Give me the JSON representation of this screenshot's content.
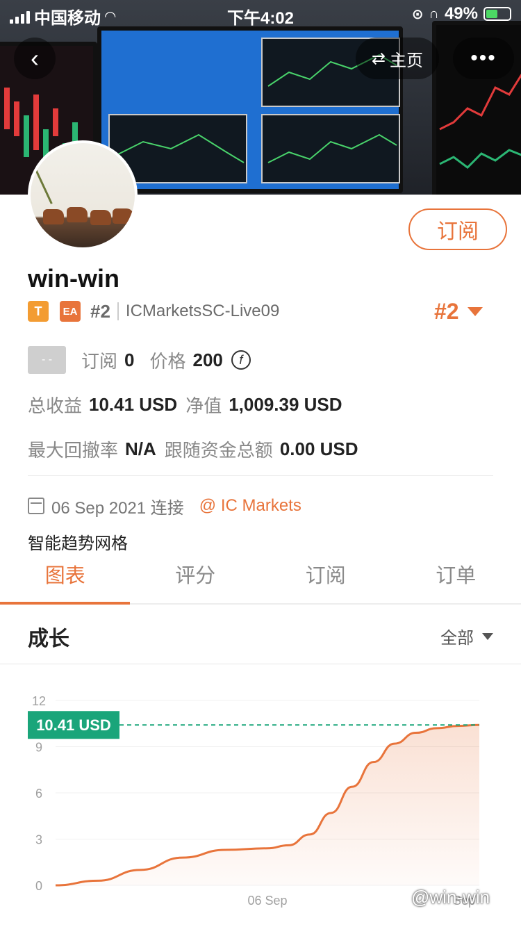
{
  "status_bar": {
    "carrier": "中国移动",
    "time": "下午4:02",
    "battery": "49%"
  },
  "nav": {
    "back_icon": "chevron-left-icon",
    "home_label": "主页",
    "home_icon": "swap-arrows-icon",
    "more_icon": "more-dots-icon"
  },
  "profile": {
    "username": "win-win",
    "subscribe_label": "订阅",
    "tag_t": "T",
    "tag_ea": "EA",
    "rank": "#2",
    "server": "ICMarketsSC-Live09",
    "rank_selector": "#2"
  },
  "stats": {
    "placeholder_box": "- -",
    "subscriptions_label": "订阅",
    "subscriptions_value": "0",
    "price_label": "价格",
    "price_value": "200",
    "total_profit_label": "总收益",
    "total_profit_value": "10.41 USD",
    "equity_label": "净值",
    "equity_value": "1,009.39 USD",
    "max_drawdown_label": "最大回撤率",
    "max_drawdown_value": "N/A",
    "follow_funds_label": "跟随资金总额",
    "follow_funds_value": "0.00 USD"
  },
  "meta": {
    "connected_date": "06 Sep 2021 连接",
    "broker": "@ IC Markets",
    "description": "智能趋势网格"
  },
  "tabs": [
    {
      "label": "图表",
      "active": true
    },
    {
      "label": "评分",
      "active": false
    },
    {
      "label": "订阅",
      "active": false
    },
    {
      "label": "订单",
      "active": false
    }
  ],
  "section": {
    "title": "成长",
    "range_label": "全部"
  },
  "colors": {
    "accent": "#e8743b",
    "current_value_tag": "#1aa57a",
    "grid": "#f0f0f0"
  },
  "chart_data": {
    "type": "area",
    "y_ticks": [
      "12",
      "9",
      "6",
      "3",
      "0"
    ],
    "ylim": [
      0,
      12
    ],
    "x_tick_labels": [
      "06 Sep",
      "Sep"
    ],
    "current_value_label": "10.41 USD",
    "current_value": 10.41,
    "series": [
      {
        "x": [
          0,
          0.1,
          0.2,
          0.3,
          0.4,
          0.5,
          0.55,
          0.6,
          0.65,
          0.7,
          0.75,
          0.8,
          0.85,
          0.9,
          0.95,
          1.0
        ],
        "values": [
          0,
          0.3,
          1.0,
          1.8,
          2.3,
          2.4,
          2.6,
          3.3,
          4.7,
          6.4,
          8.0,
          9.2,
          9.9,
          10.2,
          10.35,
          10.41
        ]
      }
    ],
    "grid": true
  },
  "watermark": "@win-win"
}
